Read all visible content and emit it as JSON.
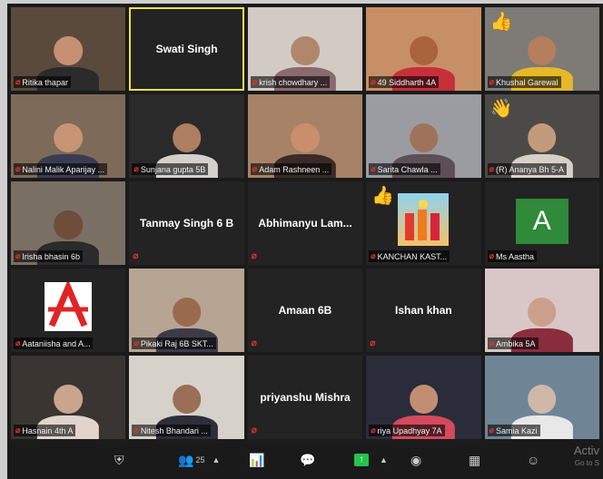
{
  "tiles": [
    {
      "name": "Ritika thapar",
      "type": "video",
      "bg": "#5a4a3c",
      "skin": "#c69075",
      "shirt": "#2b2b2b"
    },
    {
      "name": "Swati Singh",
      "type": "name",
      "active": true
    },
    {
      "name": "krish chowdhary ...",
      "type": "video",
      "bg": "#d2cbc4",
      "skin": "#b0876d",
      "shirt": "#8a6a6f"
    },
    {
      "name": "49 Siddharth 4A",
      "type": "video",
      "bg": "#c78f66",
      "skin": "#a9643d",
      "shirt": "#c7303b"
    },
    {
      "name": "Khushal Garewal",
      "type": "video",
      "bg": "#7e7a75",
      "skin": "#b57e5d",
      "shirt": "#e6b82a",
      "thumb": "👍"
    },
    {
      "name": "Nalini Malik Aparijay ...",
      "type": "video",
      "bg": "#7d6a58",
      "skin": "#c79475",
      "shirt": "#3a3c52"
    },
    {
      "name": "Sunjana gupta 5B",
      "type": "video",
      "bg": "#2a2a2a",
      "skin": "#ad7e62",
      "shirt": "#d4d0cc"
    },
    {
      "name": "Adam Rashneen ...",
      "type": "video",
      "bg": "#a78266",
      "skin": "#c98e6b",
      "shirt": "#3a2b28"
    },
    {
      "name": "Sarita Chawla ...",
      "type": "video",
      "bg": "#9a9ca2",
      "skin": "#9e7359",
      "shirt": "#5d4f55"
    },
    {
      "name": "(R) Ananya Bh 5-A",
      "type": "video",
      "bg": "#4c4a47",
      "skin": "#c39a7b",
      "shirt": "#d7d0c8",
      "thumb": "👋"
    },
    {
      "name": "Irisha bhasin 6b",
      "type": "video",
      "bg": "#7a6f63",
      "skin": "#6e4d3a",
      "shirt": "#2b2a2c"
    },
    {
      "name": "Tanmay Singh 6 B",
      "type": "name"
    },
    {
      "name": "Abhimanyu  Lam...",
      "type": "name"
    },
    {
      "name": "KANCHAN KAST...",
      "type": "drinks",
      "thumb": "👍"
    },
    {
      "name": "Ms Aastha",
      "type": "avatar",
      "letter": "A"
    },
    {
      "name": "Aataniisha and A...",
      "type": "redA"
    },
    {
      "name": "Pikaki Raj 6B SKT...",
      "type": "video",
      "bg": "#b7a593",
      "skin": "#9a6a4f",
      "shirt": "#3d3b48"
    },
    {
      "name": "Amaan 6B",
      "type": "name"
    },
    {
      "name": "Ishan khan",
      "type": "name"
    },
    {
      "name": "Ambika 5A",
      "type": "video",
      "bg": "#d8c7c6",
      "skin": "#caa08b",
      "shirt": "#8a2d3d"
    },
    {
      "name": "Hasnain 4th A",
      "type": "video",
      "bg": "#3a3530",
      "skin": "#c9a58d",
      "shirt": "#e0d4cc"
    },
    {
      "name": "Nitesh Bhandari ...",
      "type": "video",
      "bg": "#d6d1c9",
      "skin": "#9a6e57",
      "shirt": "#2e2d3a"
    },
    {
      "name": "priyanshu Mishra",
      "type": "name"
    },
    {
      "name": "riya Upadhyay 7A",
      "type": "video",
      "bg": "#2a2c3a",
      "skin": "#c28e73",
      "shirt": "#d24a5c"
    },
    {
      "name": "Samia Kazi",
      "type": "video",
      "bg": "#6f8596",
      "skin": "#d0b8a8",
      "shirt": "#e8e8e8"
    }
  ],
  "toolbar": {
    "participants_count": "25",
    "watermark_title": "Activ",
    "watermark_sub": "Go to S"
  },
  "colors": {
    "active_speaker": "#e8e34c",
    "muted_mic": "#e0312d",
    "share_button": "#27c24c"
  }
}
